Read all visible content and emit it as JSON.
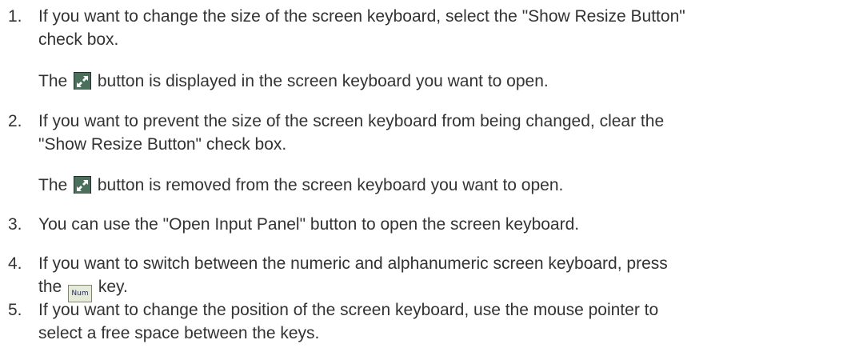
{
  "steps": [
    {
      "number": "1.",
      "text_lines": [
        "If you want to change the size of the screen keyboard, select the \"Show Resize Button\"",
        "check box."
      ],
      "note_before": "The ",
      "note_after": " button is displayed in the screen keyboard you want to open.",
      "note_icon": "resize-icon"
    },
    {
      "number": "2.",
      "text_lines": [
        "If you want to prevent the size of the screen keyboard from being changed, clear the",
        "\"Show Resize Button\" check box."
      ],
      "note_before": "The ",
      "note_after": " button is removed from the screen keyboard you want to open.",
      "note_icon": "resize-icon"
    },
    {
      "number": "3.",
      "text_lines": [
        "You can use the \"Open Input Panel\" button to open the screen keyboard."
      ]
    },
    {
      "number": "4.",
      "text_lines": [
        "If you want to switch between the numeric and alphanumeric screen keyboard, press"
      ],
      "line2_before": "the ",
      "line2_after": " key.",
      "key_icon_label": "Num"
    },
    {
      "number": "5.",
      "text_lines": [
        "If you want to change the position of the screen keyboard, use the mouse pointer to",
        "select a free space between the keys."
      ]
    }
  ],
  "colors": {
    "text": "#333333",
    "resize_icon_bg": "#4a6f5a",
    "num_key_bg": "#e6ead8"
  }
}
